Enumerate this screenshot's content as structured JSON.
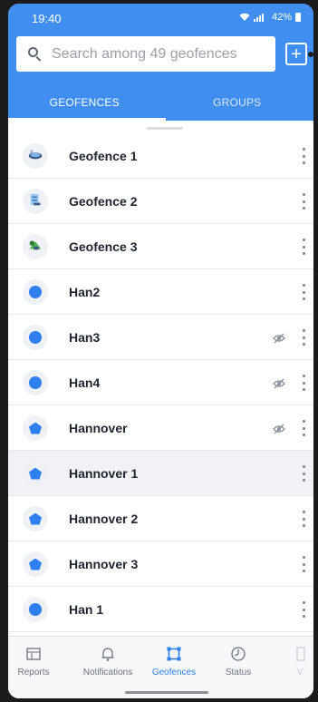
{
  "status_bar": {
    "time": "19:40",
    "battery": "42%"
  },
  "search": {
    "placeholder": "Search among 49 geofences"
  },
  "toolbar": {
    "add_label": "+"
  },
  "tabs": [
    {
      "label": "GEOFENCES",
      "active": true
    },
    {
      "label": "GROUPS",
      "active": false
    }
  ],
  "geofences": [
    {
      "name": "Geofence 1",
      "icon": "stadium-icon",
      "hidden": false
    },
    {
      "name": "Geofence 2",
      "icon": "building-icon",
      "hidden": false
    },
    {
      "name": "Geofence 3",
      "icon": "park-icon",
      "hidden": false
    },
    {
      "name": "Han2",
      "icon": "circle-icon",
      "hidden": false
    },
    {
      "name": "Han3",
      "icon": "circle-icon",
      "hidden": true
    },
    {
      "name": "Han4",
      "icon": "circle-icon",
      "hidden": true
    },
    {
      "name": "Hannover",
      "icon": "polygon-icon",
      "hidden": true
    },
    {
      "name": "Hannover 1",
      "icon": "polygon-icon",
      "hidden": false,
      "highlighted": true
    },
    {
      "name": "Hannover 2",
      "icon": "polygon-icon",
      "hidden": false
    },
    {
      "name": "Hannover 3",
      "icon": "polygon-icon",
      "hidden": false
    },
    {
      "name": "Han 1",
      "icon": "circle-icon",
      "hidden": false
    }
  ],
  "bottom_nav": [
    {
      "label": "Reports",
      "icon": "reports-icon",
      "active": false
    },
    {
      "label": "Notifications",
      "icon": "bell-icon",
      "active": false
    },
    {
      "label": "Geofences",
      "icon": "geofences-icon",
      "active": true
    },
    {
      "label": "Status",
      "icon": "status-icon",
      "active": false
    },
    {
      "label": "V",
      "icon": "more-icon",
      "active": false
    }
  ],
  "colors": {
    "primary": "#3f8ef0",
    "shape": "#2f7ff0",
    "text": "#1e2530"
  }
}
